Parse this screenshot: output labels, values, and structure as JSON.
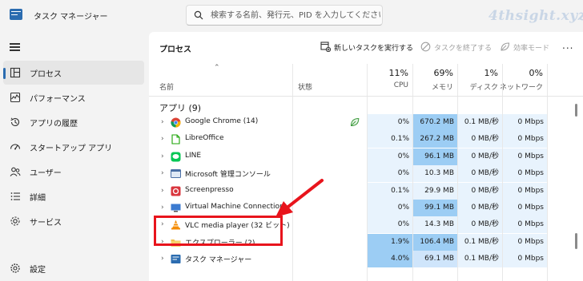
{
  "app": {
    "title": "タスク マネージャー",
    "search_placeholder": "検索する名前、発行元、PID を入力してください",
    "watermark": "4thsight.xyz"
  },
  "sidebar": {
    "items": [
      {
        "label": "プロセス",
        "icon": "processes-icon",
        "active": true
      },
      {
        "label": "パフォーマンス",
        "icon": "performance-icon",
        "active": false
      },
      {
        "label": "アプリの履歴",
        "icon": "app-history-icon",
        "active": false
      },
      {
        "label": "スタートアップ アプリ",
        "icon": "startup-icon",
        "active": false
      },
      {
        "label": "ユーザー",
        "icon": "users-icon",
        "active": false
      },
      {
        "label": "詳細",
        "icon": "details-icon",
        "active": false
      },
      {
        "label": "サービス",
        "icon": "services-icon",
        "active": false
      }
    ],
    "settings_label": "設定"
  },
  "toolbar": {
    "title": "プロセス",
    "new_task": "新しいタスクを実行する",
    "end_task": "タスクを終了する",
    "efficiency": "効率モード",
    "more": "..."
  },
  "table": {
    "columns": {
      "name": "名前",
      "status": "状態",
      "cpu": {
        "pct": "11%",
        "label": "CPU"
      },
      "memory": {
        "pct": "69%",
        "label": "メモリ"
      },
      "disk": {
        "pct": "1%",
        "label": "ディスク"
      },
      "network": {
        "pct": "0%",
        "label": "ネットワーク"
      }
    },
    "group_title": "アプリ (9)",
    "rows": [
      {
        "name": "Google Chrome (14)",
        "icon": "chrome-icon",
        "cpu": "0%",
        "memory": "670.2 MB",
        "disk": "0.1 MB/秒",
        "network": "0 Mbps",
        "eco": true
      },
      {
        "name": "LibreOffice",
        "icon": "libreoffice-icon",
        "cpu": "0.1%",
        "memory": "267.2 MB",
        "disk": "0 MB/秒",
        "network": "0 Mbps",
        "eco": false
      },
      {
        "name": "LINE",
        "icon": "line-icon",
        "cpu": "0%",
        "memory": "96.1 MB",
        "disk": "0 MB/秒",
        "network": "0 Mbps",
        "eco": false
      },
      {
        "name": "Microsoft 管理コンソール",
        "icon": "mmc-icon",
        "cpu": "0%",
        "memory": "10.3 MB",
        "disk": "0 MB/秒",
        "network": "0 Mbps",
        "eco": false
      },
      {
        "name": "Screenpresso",
        "icon": "screenpresso-icon",
        "cpu": "0.1%",
        "memory": "29.9 MB",
        "disk": "0 MB/秒",
        "network": "0 Mbps",
        "eco": false
      },
      {
        "name": "Virtual Machine Connection",
        "icon": "vm-icon",
        "cpu": "0%",
        "memory": "99.1 MB",
        "disk": "0 MB/秒",
        "network": "0 Mbps",
        "eco": false
      },
      {
        "name": "VLC media player (32 ビット)",
        "icon": "vlc-icon",
        "cpu": "0%",
        "memory": "14.3 MB",
        "disk": "0 MB/秒",
        "network": "0 Mbps",
        "eco": false
      },
      {
        "name": "エクスプローラー (2)",
        "icon": "explorer-icon",
        "cpu": "1.9%",
        "memory": "106.4 MB",
        "disk": "0.1 MB/秒",
        "network": "0 Mbps",
        "eco": false
      },
      {
        "name": "タスク マネージャー",
        "icon": "task-manager-icon",
        "cpu": "4.0%",
        "memory": "69.1 MB",
        "disk": "0.1 MB/秒",
        "network": "0 Mbps",
        "eco": false
      }
    ]
  },
  "colors": {
    "accent": "#2b6cb0",
    "heat_light": "#e8f3fd",
    "heat_mid": "#cfe5fb",
    "heat_strong": "#9ccdf4",
    "annotation_red": "#e8141c"
  }
}
